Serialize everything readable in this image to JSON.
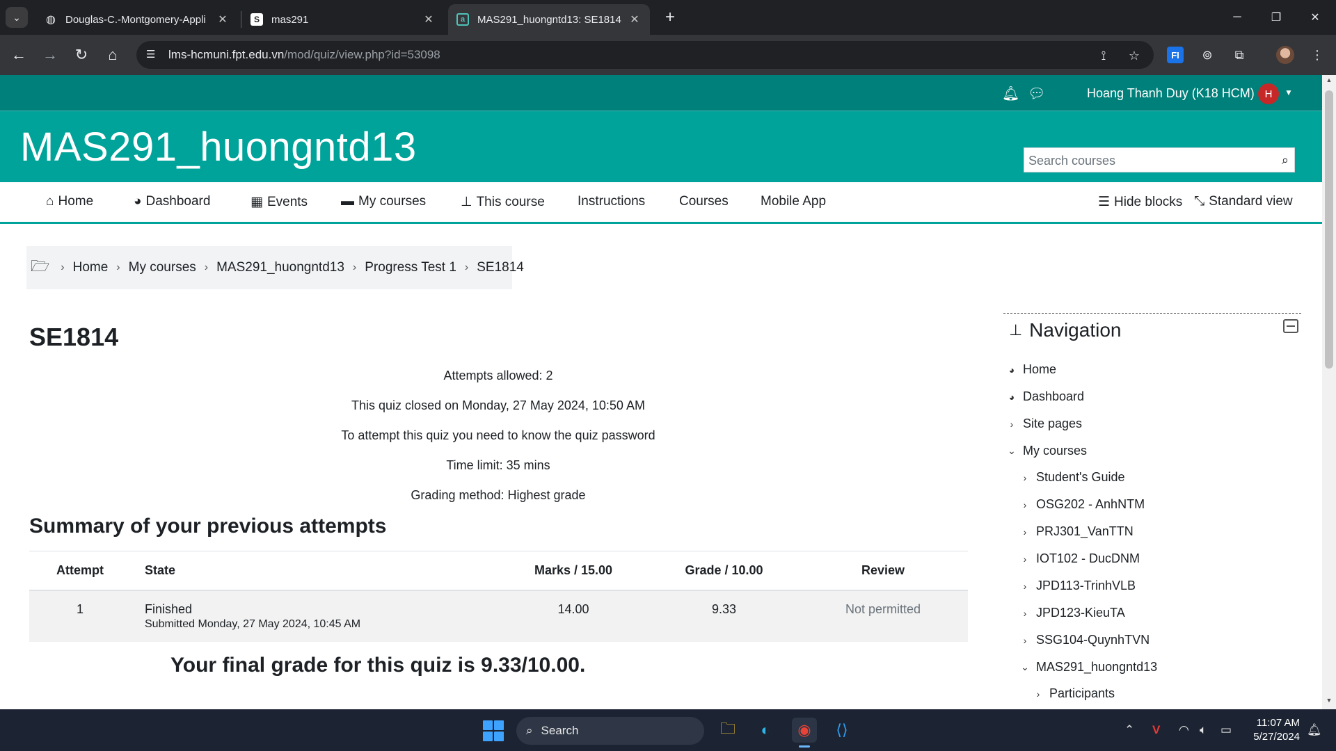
{
  "browser": {
    "tabs": [
      {
        "title": "Douglas-C.-Montgomery-Appli",
        "favicon": "globe-icon"
      },
      {
        "title": "mas291",
        "favicon": "S"
      },
      {
        "title": "MAS291_huongntd13: SE1814",
        "favicon": "moodle-icon"
      }
    ],
    "url_domain": "lms-hcmuni.fpt.edu.vn",
    "url_path": "/mod/quiz/view.php?id=53098",
    "extension_label": "FI"
  },
  "site": {
    "user_name": "Hoang Thanh Duy (K18 HCM)",
    "avatar_letter": "H",
    "course_title": "MAS291_huongntd13",
    "search_placeholder": "Search courses",
    "nav": [
      {
        "label": "Home",
        "icon": "home-icon"
      },
      {
        "label": "Dashboard",
        "icon": "dashboard-icon"
      },
      {
        "label": "Events",
        "icon": "calendar-icon"
      },
      {
        "label": "My courses",
        "icon": "briefcase-icon"
      },
      {
        "label": "This course",
        "icon": "sitemap-icon"
      },
      {
        "label": "Instructions"
      },
      {
        "label": "Courses"
      },
      {
        "label": "Mobile App"
      }
    ],
    "hide_blocks": "Hide blocks",
    "standard_view": "Standard view",
    "theme_color": "#00a39a",
    "topbar_color": "#00807a"
  },
  "breadcrumb": [
    "Home",
    "My courses",
    "MAS291_huongntd13",
    "Progress Test 1",
    "SE1814"
  ],
  "quiz": {
    "heading": "SE1814",
    "info": [
      "Attempts allowed: 2",
      "This quiz closed on Monday, 27 May 2024, 10:50 AM",
      "To attempt this quiz you need to know the quiz password",
      "Time limit: 35 mins",
      "Grading method: Highest grade"
    ],
    "summary_title": "Summary of your previous attempts",
    "columns": [
      "Attempt",
      "State",
      "Marks / 15.00",
      "Grade / 10.00",
      "Review"
    ],
    "attempts": [
      {
        "attempt": "1",
        "state": "Finished",
        "submitted": "Submitted Monday, 27 May 2024, 10:45 AM",
        "marks": "14.00",
        "grade": "9.33",
        "review": "Not permitted"
      }
    ],
    "final_grade": "Your final grade for this quiz is 9.33/10.00."
  },
  "navigation_block": {
    "title": "Navigation",
    "items": [
      {
        "label": "Home",
        "icon": "dashboard-icon"
      },
      {
        "label": "Dashboard",
        "icon": "dashboard-icon"
      },
      {
        "label": "Site pages",
        "icon": "chevron-right-icon"
      },
      {
        "label": "My courses",
        "icon": "chevron-down-icon"
      },
      {
        "label": "Student's Guide",
        "icon": "chevron-right-icon"
      },
      {
        "label": "OSG202 - AnhNTM",
        "icon": "chevron-right-icon"
      },
      {
        "label": "PRJ301_VanTTN",
        "icon": "chevron-right-icon"
      },
      {
        "label": "IOT102 - DucDNM",
        "icon": "chevron-right-icon"
      },
      {
        "label": "JPD113-TrinhVLB",
        "icon": "chevron-right-icon"
      },
      {
        "label": "JPD123-KieuTA",
        "icon": "chevron-right-icon"
      },
      {
        "label": "SSG104-QuynhTVN",
        "icon": "chevron-right-icon"
      },
      {
        "label": "MAS291_huongntd13",
        "icon": "chevron-down-icon"
      },
      {
        "label": "Participants",
        "icon": "chevron-right-icon"
      }
    ]
  },
  "taskbar": {
    "search_label": "Search",
    "time": "11:07 AM",
    "date": "5/27/2024"
  }
}
